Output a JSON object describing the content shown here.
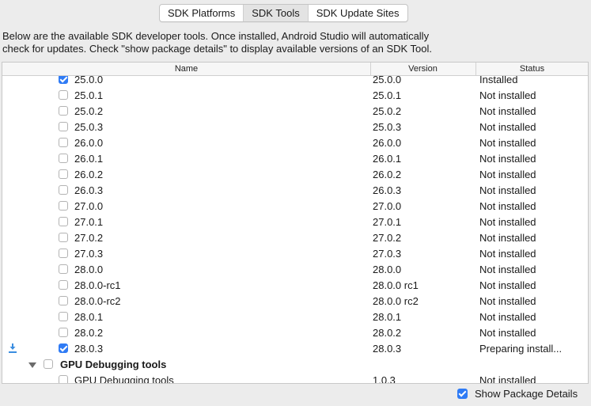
{
  "tabs": [
    {
      "label": "SDK Platforms",
      "selected": false
    },
    {
      "label": "SDK Tools",
      "selected": true
    },
    {
      "label": "SDK Update Sites",
      "selected": false
    }
  ],
  "description": {
    "line1": "Below are the available SDK developer tools. Once installed, Android Studio will automatically",
    "line2": "check for updates. Check \"show package details\" to display available versions of an SDK Tool."
  },
  "table": {
    "headers": {
      "name": "Name",
      "version": "Version",
      "status": "Status"
    },
    "rows": [
      {
        "name": "25.0.0",
        "version": "25.0.0",
        "status": "Installed",
        "checked": true
      },
      {
        "name": "25.0.1",
        "version": "25.0.1",
        "status": "Not installed",
        "checked": false
      },
      {
        "name": "25.0.2",
        "version": "25.0.2",
        "status": "Not installed",
        "checked": false
      },
      {
        "name": "25.0.3",
        "version": "25.0.3",
        "status": "Not installed",
        "checked": false
      },
      {
        "name": "26.0.0",
        "version": "26.0.0",
        "status": "Not installed",
        "checked": false
      },
      {
        "name": "26.0.1",
        "version": "26.0.1",
        "status": "Not installed",
        "checked": false
      },
      {
        "name": "26.0.2",
        "version": "26.0.2",
        "status": "Not installed",
        "checked": false
      },
      {
        "name": "26.0.3",
        "version": "26.0.3",
        "status": "Not installed",
        "checked": false
      },
      {
        "name": "27.0.0",
        "version": "27.0.0",
        "status": "Not installed",
        "checked": false
      },
      {
        "name": "27.0.1",
        "version": "27.0.1",
        "status": "Not installed",
        "checked": false
      },
      {
        "name": "27.0.2",
        "version": "27.0.2",
        "status": "Not installed",
        "checked": false
      },
      {
        "name": "27.0.3",
        "version": "27.0.3",
        "status": "Not installed",
        "checked": false
      },
      {
        "name": "28.0.0",
        "version": "28.0.0",
        "status": "Not installed",
        "checked": false
      },
      {
        "name": "28.0.0-rc1",
        "version": "28.0.0 rc1",
        "status": "Not installed",
        "checked": false
      },
      {
        "name": "28.0.0-rc2",
        "version": "28.0.0 rc2",
        "status": "Not installed",
        "checked": false
      },
      {
        "name": "28.0.1",
        "version": "28.0.1",
        "status": "Not installed",
        "checked": false
      },
      {
        "name": "28.0.2",
        "version": "28.0.2",
        "status": "Not installed",
        "checked": false
      },
      {
        "name": "28.0.3",
        "version": "28.0.3",
        "status": "Preparing install...",
        "checked": true,
        "icon": "download-icon"
      }
    ],
    "group": {
      "name": "GPU Debugging tools",
      "checked": false,
      "expanded": true
    },
    "group_rows": [
      {
        "name": "GPU Debugging tools",
        "version": "1.0.3",
        "status": "Not installed",
        "checked": false
      }
    ]
  },
  "footer": {
    "show_package_details_label": "Show Package Details",
    "checked": true
  },
  "colors": {
    "accent": "#2f7bf5",
    "download_icon": "#3a8de0"
  }
}
